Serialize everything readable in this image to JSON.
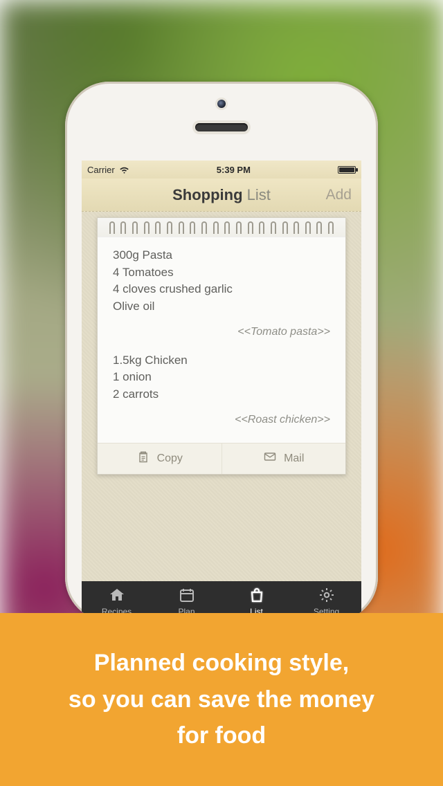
{
  "status": {
    "carrier": "Carrier",
    "time": "5:39 PM"
  },
  "navbar": {
    "title_bold": "Shopping",
    "title_light": "List",
    "add_label": "Add"
  },
  "list": {
    "groups": [
      {
        "items": [
          "300g Pasta",
          "4 Tomatoes",
          "4 cloves crushed garlic",
          "Olive oil"
        ],
        "recipe": "<<Tomato pasta>>"
      },
      {
        "items": [
          "1.5kg Chicken",
          "1 onion",
          "2 carrots"
        ],
        "recipe": "<<Roast chicken>>"
      }
    ]
  },
  "actions": {
    "copy": "Copy",
    "mail": "Mail"
  },
  "tabs": {
    "recipes": "Recipes",
    "plan": "Plan",
    "list": "List",
    "setting": "Setting",
    "active": "list"
  },
  "banner": {
    "line1": "Planned cooking style,",
    "line2": "so you can save the money",
    "line3": "for food"
  }
}
